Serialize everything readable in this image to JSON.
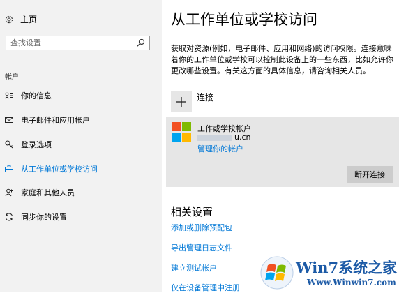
{
  "sidebar": {
    "home_label": "主页",
    "search_placeholder": "查找设置",
    "section_label": "帐户",
    "items": [
      {
        "label": "你的信息",
        "icon": "person-card-icon"
      },
      {
        "label": "电子邮件和应用帐户",
        "icon": "mail-icon"
      },
      {
        "label": "登录选项",
        "icon": "key-icon"
      },
      {
        "label": "从工作单位或学校访问",
        "icon": "briefcase-icon",
        "active": true
      },
      {
        "label": "家庭和其他人员",
        "icon": "person-add-icon"
      },
      {
        "label": "同步你的设置",
        "icon": "sync-icon"
      }
    ]
  },
  "main": {
    "title": "从工作单位或学校访问",
    "description": "获取对资源(例如，电子邮件、应用和网络)的访问权限。连接意味着你的工作单位或学校可以控制此设备上的一些东西，比如允许你更改哪些设置。有关这方面的具体信息，请咨询相关人员。",
    "connect_label": "连接",
    "account": {
      "type_label": "工作或学校帐户",
      "domain_suffix": "u.cn",
      "manage_link": "管理你的帐户",
      "disconnect_label": "断开连接"
    },
    "related_title": "相关设置",
    "related_links": [
      "添加或删除预配包",
      "导出管理日志文件",
      "建立测试帐户",
      "仅在设备管理中注册"
    ]
  },
  "watermark": {
    "brand": "Win7系统之家",
    "url": "Www.Winwin7.com"
  },
  "colors": {
    "accent": "#0078d7",
    "sidebar_bg": "#f2f2f2",
    "panel_bg": "#e6e6e6"
  }
}
